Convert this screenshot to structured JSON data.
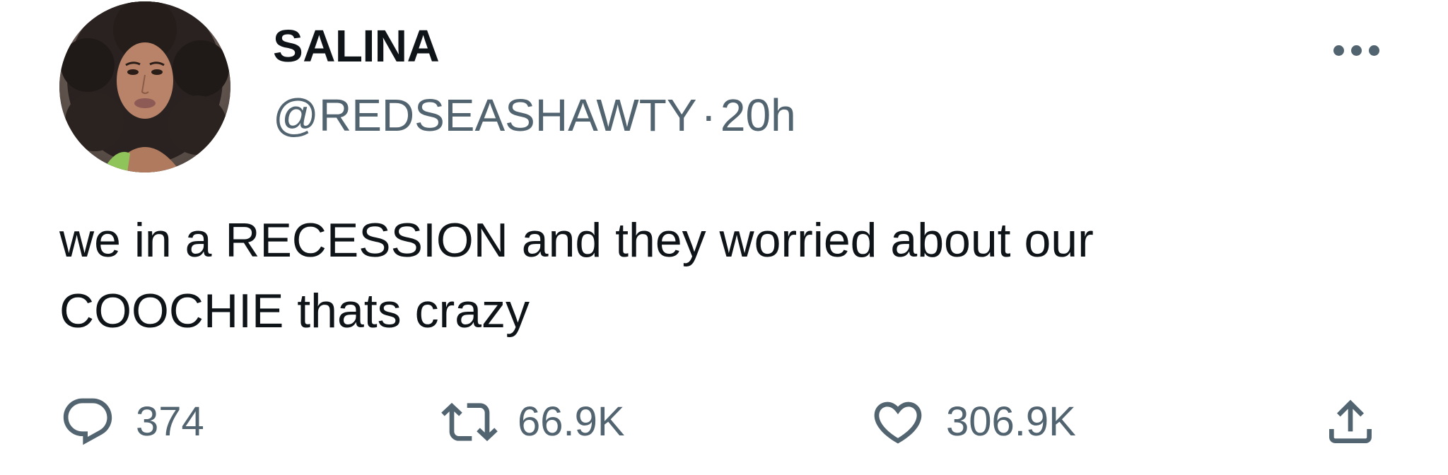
{
  "author": {
    "display_name": "SALINA",
    "handle": "@REDSEASHAWTY",
    "separator": "·",
    "time": "20h"
  },
  "tweet": {
    "text": "we in a RECESSION and they worried about our\nCOOCHIE thats crazy"
  },
  "actions": {
    "replies": "374",
    "retweets": "66.9K",
    "likes": "306.9K"
  },
  "icons": {
    "reply": "speech-bubble-icon",
    "retweet": "retweet-arrows-icon",
    "like": "heart-icon",
    "share": "share-upload-icon",
    "more": "more-dots-icon"
  },
  "colors": {
    "text": "#0f1419",
    "secondary": "#536471",
    "background": "#ffffff"
  }
}
